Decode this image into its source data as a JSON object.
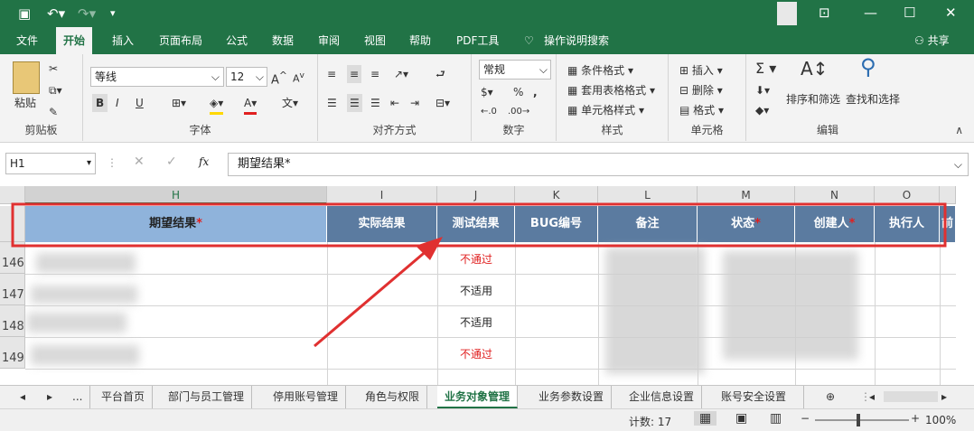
{
  "title_bar": {
    "quick_access": [
      "save-icon",
      "undo-icon",
      "redo-icon",
      "customize-icon"
    ],
    "window_controls": [
      "ribbon-options-icon",
      "minimize-icon",
      "maximize-icon",
      "close-icon"
    ]
  },
  "ribbon_tabs": [
    "文件",
    "开始",
    "插入",
    "页面布局",
    "公式",
    "数据",
    "审阅",
    "视图",
    "帮助",
    "PDF工具",
    "操作说明搜索",
    "共享"
  ],
  "ribbon": {
    "clipboard": {
      "paste": "粘贴",
      "label": "剪贴板"
    },
    "font": {
      "name": "等线",
      "size": "12",
      "bold": "B",
      "italic": "I",
      "underline": "U",
      "label": "字体"
    },
    "alignment": {
      "label": "对齐方式"
    },
    "number": {
      "format": "常规",
      "percent": "%",
      "comma": ",",
      "label": "数字"
    },
    "styles": {
      "conditional": "条件格式",
      "table": "套用表格格式",
      "cell": "单元格样式",
      "label": "样式"
    },
    "cells": {
      "insert": "插入",
      "delete": "删除",
      "format": "格式",
      "label": "单元格"
    },
    "editing": {
      "sum": "Σ",
      "sort": "排序和筛选",
      "find": "查找和选择",
      "label": "编辑"
    }
  },
  "formula_bar": {
    "name_box": "H1",
    "fx": "fx",
    "content": "期望结果*"
  },
  "columns": [
    "H",
    "I",
    "J",
    "K",
    "L",
    "M",
    "N",
    "O"
  ],
  "header_row": {
    "h": "期望结果",
    "i": "实际结果",
    "j": "测试结果",
    "k": "BUG编号",
    "l": "备注",
    "m": "状态",
    "n": "创建人",
    "o": "执行人",
    "p": "前",
    "required_mark": "*"
  },
  "rows": [
    {
      "num": "146",
      "j": "不通过",
      "color": "#e02020"
    },
    {
      "num": "147",
      "j": "不适用",
      "color": "#222222"
    },
    {
      "num": "148",
      "j": "不适用",
      "color": "#222222"
    },
    {
      "num": "149",
      "j": "不通过",
      "color": "#e02020"
    }
  ],
  "sheet_tabs": [
    "...",
    "平台首页",
    "部门与员工管理",
    "停用账号管理",
    "角色与权限",
    "业务对象管理",
    "业务参数设置",
    "企业信息设置",
    "账号安全设置"
  ],
  "active_sheet": "业务对象管理",
  "status": {
    "count": "计数: 17",
    "zoom": "100%"
  },
  "colors": {
    "excel_green": "#217346",
    "selected_header": "#8fb3db",
    "header_fill": "#5b7ba0",
    "annotation_red": "#e03030"
  }
}
